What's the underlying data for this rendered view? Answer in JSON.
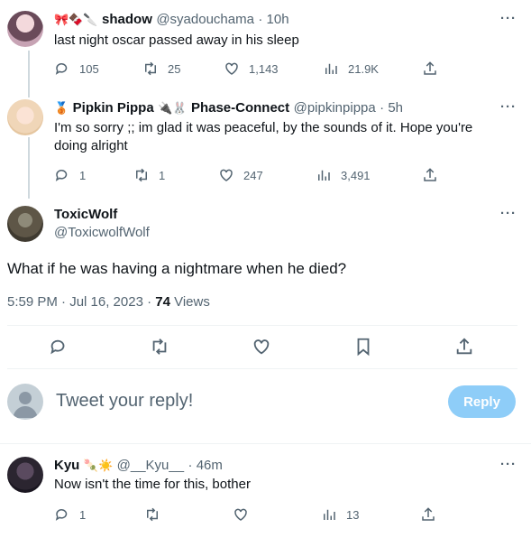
{
  "tweets": [
    {
      "name": "shadow",
      "emojis": "🎀🍫🔪",
      "handle": "@syadouchama",
      "time": "· 10h",
      "text": "last night oscar passed away in his sleep",
      "replies": "105",
      "retweets": "25",
      "likes": "1,143",
      "views": "21.9K"
    },
    {
      "name": "Pipkin Pippa",
      "badge": "🥉",
      "name2": "Phase-Connect",
      "emojis": "🔌🐰",
      "handle": "@pipkinpippa",
      "time": "· 5h",
      "text_line1": "I'm so sorry ;; im glad it was peaceful, by the sounds of it. Hope you're",
      "text_line2": "doing alright",
      "replies": "1",
      "retweets": "1",
      "likes": "247",
      "views": "3,491"
    }
  ],
  "main": {
    "name": "ToxicWolf",
    "handle": "@ToxicwolfWolf",
    "text": "What if he was having a nightmare when he died?",
    "timestamp": "5:59 PM · Jul 16, 2023 · ",
    "views_count": "74",
    "views_label": " Views"
  },
  "compose": {
    "placeholder": "Tweet your reply!",
    "button": "Reply"
  },
  "reply": {
    "name": "Kyu",
    "emojis": "🍡☀️",
    "handle": "@__Kyu__",
    "time": "· 46m",
    "text": "Now isn't the time for this, bother",
    "replies": "1",
    "views": "13"
  },
  "colors": {
    "accent": "#1d9bf0",
    "reply_button_disabled": "#8ecdf8",
    "muted": "#536471"
  }
}
